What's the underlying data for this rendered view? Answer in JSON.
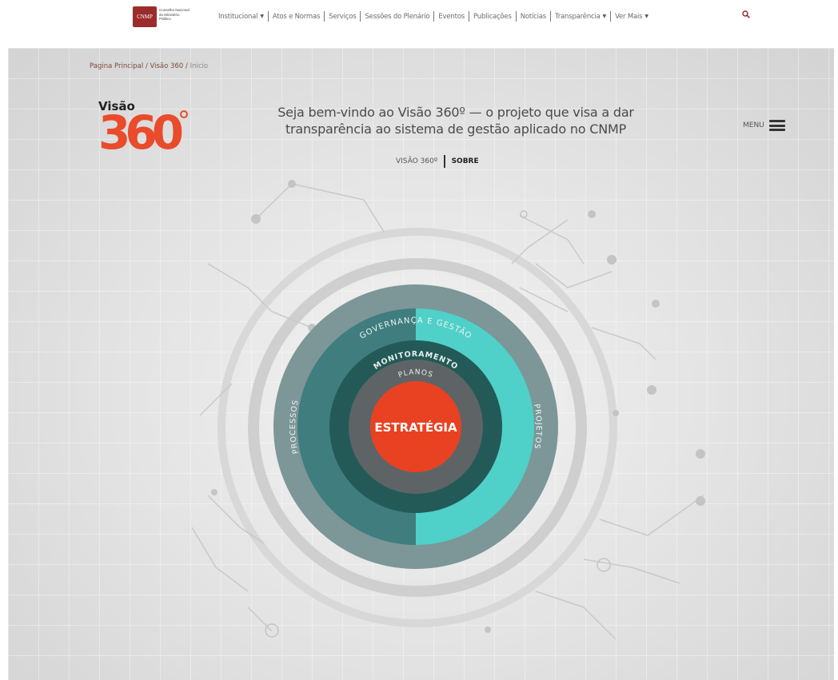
{
  "header": {
    "logo_mark": "CNMP",
    "logo_caption": "Conselho Nacional do Ministério Público",
    "nav": [
      {
        "label": "Institucional",
        "dropdown": true
      },
      {
        "label": "Atos e Normas",
        "dropdown": false
      },
      {
        "label": "Serviços",
        "dropdown": false
      },
      {
        "label": "Sessões do Plenário",
        "dropdown": false
      },
      {
        "label": "Eventos",
        "dropdown": false
      },
      {
        "label": "Publicações",
        "dropdown": false
      },
      {
        "label": "Notícias",
        "dropdown": false
      },
      {
        "label": "Transparência",
        "dropdown": true
      },
      {
        "label": "Ver Mais",
        "dropdown": true
      }
    ],
    "search_icon": "search-icon"
  },
  "breadcrumb": {
    "home": "Pagina Principal",
    "section": "Visão 360",
    "current": "Inicio",
    "separator": "/"
  },
  "logo": {
    "word": "Visão",
    "number": "360"
  },
  "welcome": "Seja bem-vindo ao Visão 360º — o projeto que visa a dar transparência ao sistema de gestão aplicado no CNMP",
  "menu_label": "MENU",
  "subnav": [
    {
      "label": "VISÃO 360º",
      "active": false
    },
    {
      "label": "SOBRE",
      "active": true
    }
  ],
  "diagram": {
    "outer": "GOVERNANÇA E GESTÃO",
    "left": "PROCESSOS",
    "right": "PROJETOS",
    "ring3": "MONITORAMENTO",
    "ring4": "PLANOS",
    "center": "ESTRATÉGIA",
    "colors": {
      "outer": "#7d9698",
      "left_ring": "#3f7d7f",
      "right_ring": "#4fd0c8",
      "ring3": "#235a57",
      "ring4": "#5e6466",
      "center": "#e84222"
    }
  }
}
